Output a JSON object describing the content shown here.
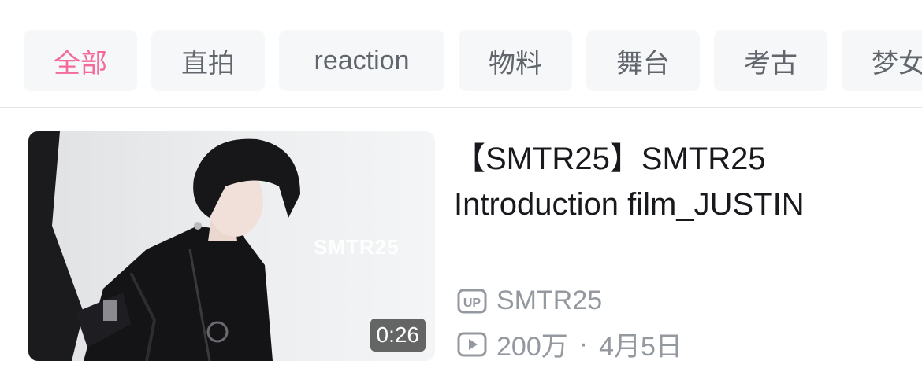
{
  "tabs": [
    {
      "label": "全部",
      "active": true,
      "width": 144
    },
    {
      "label": "直拍",
      "active": false,
      "width": 144
    },
    {
      "label": "reaction",
      "active": false,
      "width": 210
    },
    {
      "label": "物料",
      "active": false,
      "width": 144
    },
    {
      "label": "舞台",
      "active": false,
      "width": 144
    },
    {
      "label": "考古",
      "active": false,
      "width": 144
    },
    {
      "label": "梦女",
      "active": false,
      "width": 144
    }
  ],
  "video": {
    "title": "【SMTR25】SMTR25 Introduction film_JUSTIN",
    "thumbnail_watermark": "SMTR25",
    "duration": "0:26",
    "uploader_badge_icon": "up-badge-icon",
    "uploader": "SMTR25",
    "play_icon": "play-count-icon",
    "views": "200万",
    "separator": "·",
    "date": "4月5日"
  },
  "colors": {
    "accent": "#f26b9a",
    "tab_bg": "#f6f7f8",
    "tab_text": "#61666d",
    "meta_text": "#9499a0",
    "title_text": "#18191c"
  }
}
